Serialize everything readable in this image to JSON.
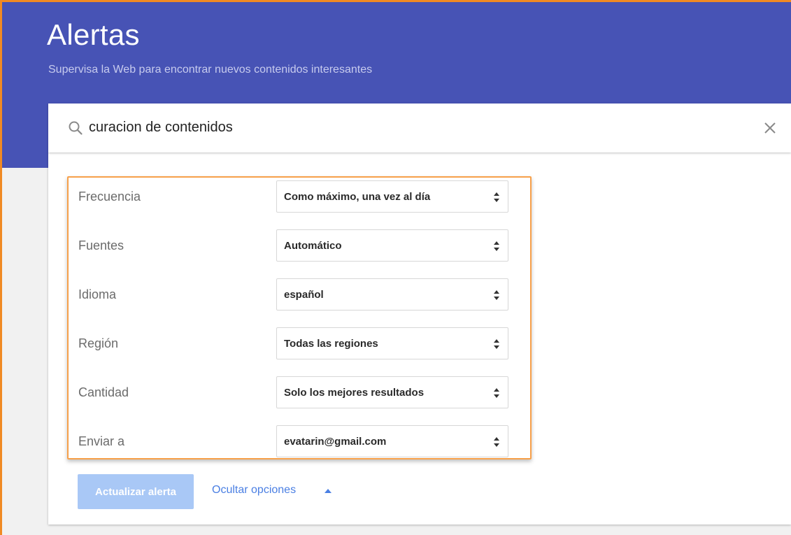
{
  "header": {
    "title": "Alertas",
    "subtitle": "Supervisa la Web para encontrar nuevos contenidos interesantes"
  },
  "search": {
    "value": "curacion de contenidos",
    "icon": "search-icon",
    "clear_icon": "close-icon"
  },
  "options": [
    {
      "label": "Frecuencia",
      "value": "Como máximo, una vez al día"
    },
    {
      "label": "Fuentes",
      "value": "Automático"
    },
    {
      "label": "Idioma",
      "value": "español"
    },
    {
      "label": "Región",
      "value": "Todas las regiones"
    },
    {
      "label": "Cantidad",
      "value": "Solo los mejores resultados"
    },
    {
      "label": "Enviar a",
      "value": "evatarin@gmail.com"
    }
  ],
  "actions": {
    "update_label": "Actualizar alerta",
    "toggle_label": "Ocultar opciones",
    "toggle_icon": "caret-up-icon"
  },
  "colors": {
    "header_bg": "#4753b5",
    "highlight": "#f7a04a",
    "link": "#4a7fe3",
    "button_disabled": "#a9c8f6"
  }
}
